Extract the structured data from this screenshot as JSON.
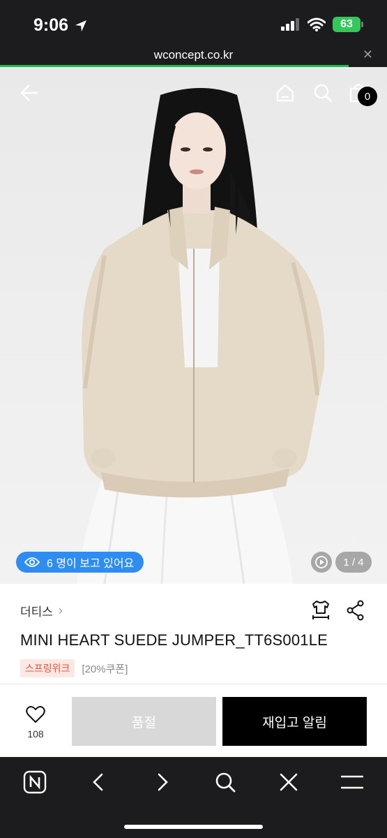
{
  "status": {
    "time": "9:06",
    "battery": "63"
  },
  "browser": {
    "url": "wconcept.co.kr",
    "load_progress": 0.9
  },
  "header": {
    "cart_count": "0"
  },
  "gallery": {
    "viewers_text": "6 명이 보고 있어요",
    "page_indicator": "1 / 4"
  },
  "product": {
    "brand": "더티스",
    "title": "MINI HEART SUEDE JUMPER_TT6S001LE",
    "tag_event": "스프링위크",
    "tag_coupon": "[20%쿠폰]"
  },
  "actions": {
    "like_count": "108",
    "soldout_label": "품절",
    "restock_label": "재입고 알림"
  },
  "icons": [
    "back-arrow-icon",
    "home-icon",
    "search-icon",
    "shopping-bag-icon",
    "eye-icon",
    "play-icon",
    "size-guide-icon",
    "share-icon",
    "heart-icon",
    "naver-icon",
    "chevron-left-icon",
    "chevron-right-icon",
    "close-icon",
    "menu-icon"
  ],
  "colors": {
    "accent_green": "#1db954",
    "viewers_blue": "#2f8cf0",
    "tag_red": "#e5533b"
  }
}
